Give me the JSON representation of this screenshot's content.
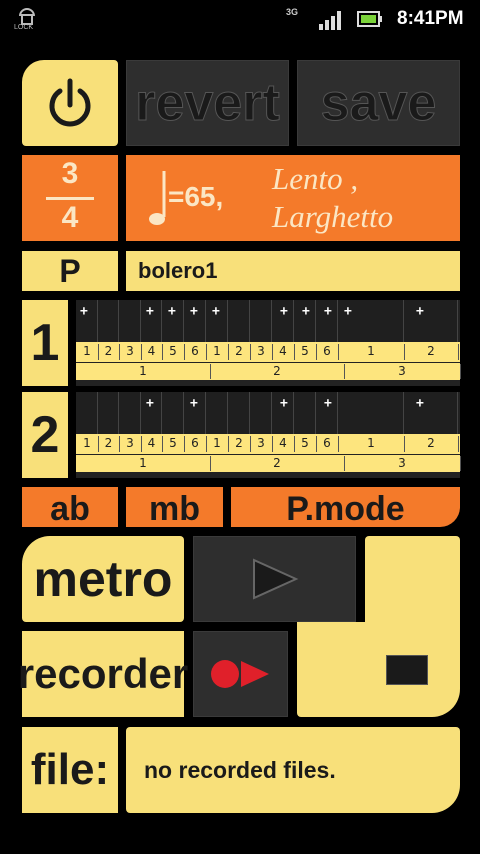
{
  "status_bar": {
    "lock_label": "LOCK",
    "network": "3G",
    "time": "8:41PM"
  },
  "toolbar": {
    "power_icon": "power-icon",
    "revert_label": "revert",
    "save_label": "save"
  },
  "tempo": {
    "time_sig_top": "3",
    "time_sig_bottom": "4",
    "bpm_text": "=65,",
    "tempo_name_line1": "Lento ,",
    "tempo_name_line2": "Larghetto"
  },
  "pattern": {
    "p_label": "P",
    "name": "bolero1"
  },
  "tracks": [
    {
      "number": "1",
      "steps": [
        "1",
        "2",
        "3",
        "4",
        "5",
        "6",
        "1",
        "2",
        "3",
        "4",
        "5",
        "6",
        "1",
        "2"
      ],
      "bars": [
        "1",
        "2",
        "3"
      ]
    },
    {
      "number": "2",
      "steps": [
        "1",
        "2",
        "3",
        "4",
        "5",
        "6",
        "1",
        "2",
        "3",
        "4",
        "5",
        "6",
        "1",
        "2"
      ],
      "bars": [
        "1",
        "2",
        "3"
      ]
    }
  ],
  "modes": {
    "ab_label": "ab",
    "mb_label": "mb",
    "pmode_label": "P.mode"
  },
  "transport": {
    "metro_label": "metro",
    "recorder_label": "recorder",
    "file_label": "file:",
    "file_status": "no recorded files."
  },
  "colors": {
    "yellow": "#f8e07a",
    "orange": "#f47a2a",
    "dark": "#2e2e2e",
    "record_red": "#e0202a"
  }
}
